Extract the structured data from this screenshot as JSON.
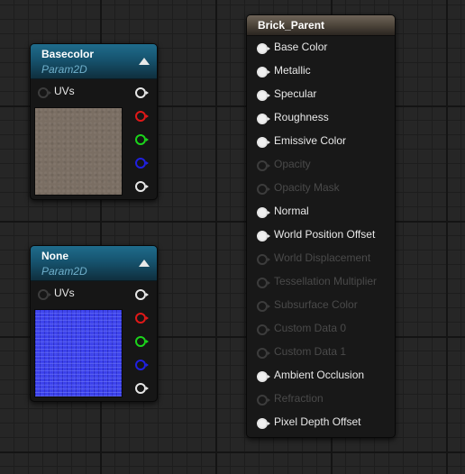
{
  "basecolor_node": {
    "title": "Basecolor",
    "subtitle": "Param2D",
    "uv_label": "UVs"
  },
  "none_node": {
    "title": "None",
    "subtitle": "Param2D",
    "uv_label": "UVs"
  },
  "material_node": {
    "title": "Brick_Parent",
    "inputs": [
      {
        "label": "Base Color",
        "enabled": true
      },
      {
        "label": "Metallic",
        "enabled": true
      },
      {
        "label": "Specular",
        "enabled": true
      },
      {
        "label": "Roughness",
        "enabled": true
      },
      {
        "label": "Emissive Color",
        "enabled": true
      },
      {
        "label": "Opacity",
        "enabled": false
      },
      {
        "label": "Opacity Mask",
        "enabled": false
      },
      {
        "label": "Normal",
        "enabled": true
      },
      {
        "label": "World Position Offset",
        "enabled": true
      },
      {
        "label": "World Displacement",
        "enabled": false
      },
      {
        "label": "Tessellation Multiplier",
        "enabled": false
      },
      {
        "label": "Subsurface Color",
        "enabled": false
      },
      {
        "label": "Custom Data 0",
        "enabled": false
      },
      {
        "label": "Custom Data 1",
        "enabled": false
      },
      {
        "label": "Ambient Occlusion",
        "enabled": true
      },
      {
        "label": "Refraction",
        "enabled": false
      },
      {
        "label": "Pixel Depth Offset",
        "enabled": true
      }
    ]
  },
  "colors": {
    "param_header": "#1f6c8c",
    "param_subtitle": "#6fb0cc",
    "main_header": "#6e6458",
    "pin_red": "#e01818",
    "pin_green": "#1bd41b",
    "pin_blue": "#2020e0",
    "pin_white": "#e6e6e6"
  },
  "icons": {
    "collapse": "triangle-up-icon",
    "pin": "pin-circle-icon"
  }
}
